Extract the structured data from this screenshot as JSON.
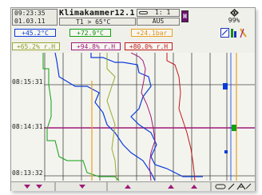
{
  "header": {
    "time": "09:23:35",
    "date": "01.03.11",
    "chamber_name": "Klimakammer12.1",
    "condition": "T1 > 65°C",
    "switch_state": "1: 1",
    "output_state": "AUS",
    "h_label": "H",
    "level_percent": "99%"
  },
  "values": [
    {
      "text": "+45.2°C",
      "color": "#0a3cd8"
    },
    {
      "text": "+72.9°C",
      "color": "#10a010"
    },
    {
      "text": "+24.1bar",
      "color": "#e8a020"
    },
    {
      "text": "+65.2% r.H",
      "color": "#98a830"
    },
    {
      "text": "+94.8% r.H",
      "color": "#a01a78"
    },
    {
      "text": "+80.0% r.H",
      "color": "#c01818"
    }
  ],
  "chart": {
    "time_labels": [
      "08:15:31",
      "08:14:31",
      "08:13:32"
    ],
    "series_colors": {
      "temp1": "#0a3cd8",
      "temp2": "#10a010",
      "pressure": "#e8a020",
      "rh1": "#98a830",
      "rh2": "#a01a78",
      "rh3": "#c01818"
    }
  },
  "icons": [
    "zoom-icon",
    "bar-chart-icon",
    "pen-icon",
    "navigate-icon",
    "switch-icon",
    "pen-draw-icon"
  ],
  "footer": {
    "buttons": [
      "scroll-down-1",
      "scroll-down-2",
      "scroll-down-3",
      "scroll-up-1",
      "scroll-up-2",
      "scroll-up-3"
    ]
  }
}
